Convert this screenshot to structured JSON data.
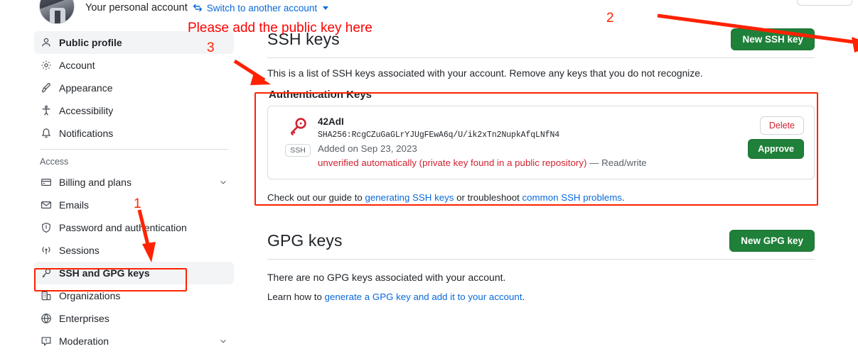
{
  "account_bar": {
    "personal_account": "Your personal account",
    "switch_icon": "switch-arrows-icon",
    "switch_link": "Switch to another account"
  },
  "sidebar": {
    "section_label": "Access",
    "items": [
      {
        "label": "Public profile",
        "icon": "person-icon",
        "selected": true,
        "chevron": false
      },
      {
        "label": "Account",
        "icon": "gear-icon",
        "selected": false,
        "chevron": false
      },
      {
        "label": "Appearance",
        "icon": "paintbrush-icon",
        "selected": false,
        "chevron": false
      },
      {
        "label": "Accessibility",
        "icon": "accessibility-icon",
        "selected": false,
        "chevron": false
      },
      {
        "label": "Notifications",
        "icon": "bell-icon",
        "selected": false,
        "chevron": false
      }
    ],
    "access_items": [
      {
        "label": "Billing and plans",
        "icon": "credit-card-icon",
        "selected": false,
        "chevron": true
      },
      {
        "label": "Emails",
        "icon": "mail-icon",
        "selected": false,
        "chevron": false
      },
      {
        "label": "Password and authentication",
        "icon": "shield-icon",
        "selected": false,
        "chevron": false
      },
      {
        "label": "Sessions",
        "icon": "broadcast-icon",
        "selected": false,
        "chevron": false
      },
      {
        "label": "SSH and GPG keys",
        "icon": "key-icon",
        "selected": true,
        "chevron": false
      },
      {
        "label": "Organizations",
        "icon": "organization-icon",
        "selected": false,
        "chevron": false
      },
      {
        "label": "Enterprises",
        "icon": "globe-icon",
        "selected": false,
        "chevron": false
      },
      {
        "label": "Moderation",
        "icon": "report-icon",
        "selected": false,
        "chevron": true
      }
    ]
  },
  "ssh_section": {
    "title": "SSH keys",
    "new_key_button": "New SSH key",
    "description": "This is a list of SSH keys associated with your account. Remove any keys that you do not recognize.",
    "auth_keys_title": "Authentication Keys",
    "key": {
      "name": "42AdI",
      "fingerprint": "SHA256:RcgCZuGaGLrYJUgFEwA6q/U/ik2xTn2NupkAfqLNfN4",
      "added": "Added on Sep 23, 2023",
      "status_warning": "unverified automatically (private key found in a public repository)",
      "status_access": "— Read/write",
      "badge": "SSH",
      "key_icon": "key-icon",
      "delete_button": "Delete",
      "approve_button": "Approve"
    },
    "guide_prefix": "Check out our guide to ",
    "guide_link_1": "generating SSH keys",
    "guide_middle": " or troubleshoot ",
    "guide_link_2": "common SSH problems",
    "guide_suffix": "."
  },
  "gpg_section": {
    "title": "GPG keys",
    "new_key_button": "New GPG key",
    "empty_text": "There are no GPG keys associated with your account.",
    "learn_prefix": "Learn how to ",
    "learn_link": "generate a GPG key and add it to your account",
    "learn_suffix": "."
  },
  "annotations": {
    "instruction": "Please add the public key here",
    "num_1": "1",
    "num_2": "2",
    "num_3": "3",
    "color": "#ff2200"
  }
}
